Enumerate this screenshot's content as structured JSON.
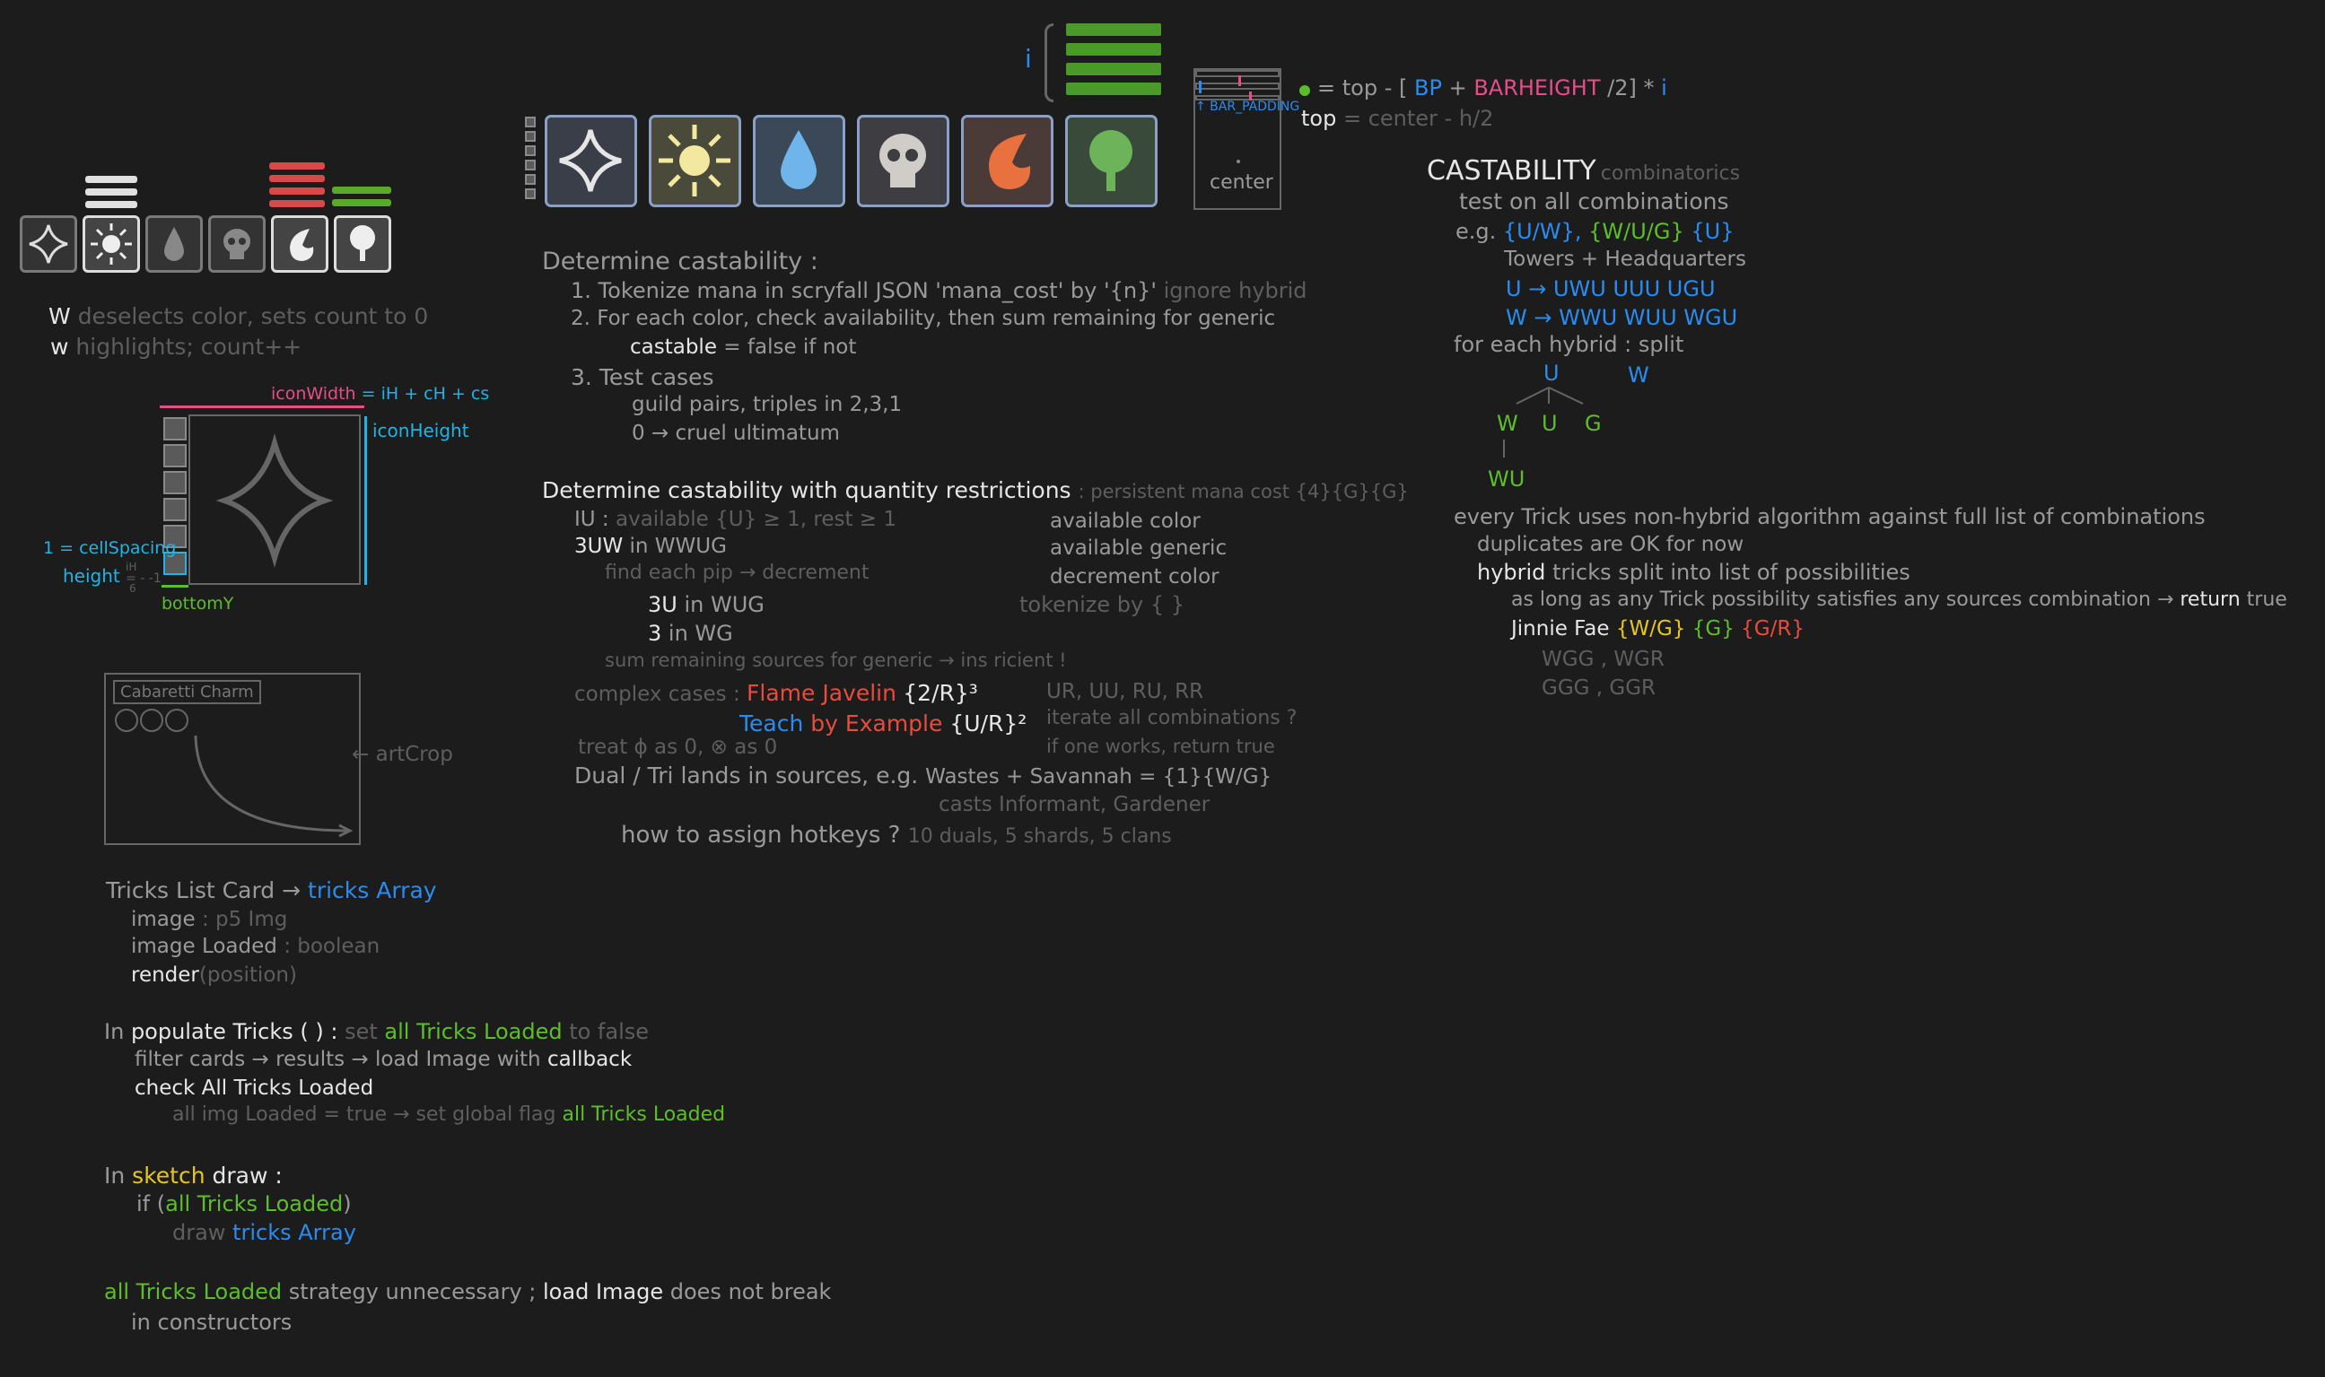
{
  "colors": {
    "blue": "#2a8cf0",
    "green": "#5cbf2a",
    "pink": "#e54f86",
    "red": "#e84c3d",
    "yellow": "#e7c520",
    "gray": "#9a9a9a",
    "dim": "#5e5e5e",
    "white": "#e6e6e6"
  },
  "icons": [
    "colorless-diamond-icon",
    "white-sun-icon",
    "blue-drop-icon",
    "black-skull-icon",
    "red-fire-icon",
    "green-tree-icon"
  ],
  "left": {
    "deselect_key": "W",
    "deselect_text": "deselects color, sets count to 0",
    "highlight_key": "w",
    "highlight_text": "highlights; count++",
    "icon_width": "iconWidth",
    "icon_width_formula": "= iH + cH + cs",
    "icon_height": "iconHeight",
    "cell_spacing": "1 = cellSpacing",
    "height_label": "height",
    "height_frac_top": "iH",
    "height_frac_bottom": "6",
    "height_minus": "= - -1",
    "bottom_y": "bottomY",
    "card_name": "Cabaretti Charm",
    "art_crop": "artCrop",
    "tricks_l1a": "Tricks List Card",
    "tricks_l1_arrow": "→",
    "tricks_l1b": "tricks Array",
    "image_key": "image",
    "image_val": ": p5 Img",
    "image_loaded_key": "image Loaded",
    "image_loaded_val": ": boolean",
    "render_key": "render",
    "render_val": "(position)",
    "populate_in": "In",
    "populate_fn": "populate Tricks ( ) :",
    "populate_set": "set",
    "populate_flag": "all Tricks Loaded",
    "populate_false": "to false",
    "filter_line_a": "filter cards → results → load Image with",
    "filter_line_b": "callback",
    "check_all": "check All Tricks Loaded",
    "all_loaded_a": "all img Loaded = true → set global flag",
    "all_loaded_b": "all Tricks Loaded",
    "sketch_in": "In",
    "sketch_word": "sketch",
    "draw_word": "draw :",
    "if_a": "if (",
    "if_b": "all Tricks Loaded",
    "if_c": ")",
    "draw2_a": "draw",
    "draw2_b": "tricks Array",
    "final_a": "all Tricks Loaded",
    "final_b": "strategy unnecessary ;",
    "final_c": "load Image",
    "final_d": "does not break",
    "final_e": "in constructors"
  },
  "top": {
    "i_label": "i",
    "formula_top": "= top - [",
    "formula_bp": "BP",
    "formula_plus": "+",
    "formula_barheight": "BARHEIGHT",
    "formula_div": "/2] *",
    "formula_i": "i",
    "top2": "top",
    "top2_rest": "= center - h/2",
    "bar_padding": "↑ BAR_PADDING",
    "center": "center"
  },
  "middle": {
    "det_title": "Determine castability :",
    "n1": "1.",
    "l1": "Tokenize mana in scryfall JSON 'mana_cost' by '{n}'",
    "l1_dim": "ignore hybrid",
    "n2": "2.",
    "l2": "For each color, check availability, then sum remaining for generic",
    "l2b_key": "castable",
    "l2b_val": "= false if not",
    "n3": "3.",
    "l3": "Test cases",
    "l3a": "guild pairs, triples in 2,3,1",
    "l3b": "0 → cruel ultimatum",
    "q_title": "Determine castability with quantity restrictions",
    "q_title_dim": ": persistent mana cost  {4}{G}{G}",
    "iu_key": "IU :",
    "iu_val": "available {U} ≥ 1, rest ≥ 1",
    "w3uw_a": "3UW",
    "w3uw_b": "in WWUG",
    "find_pip": "find each pip → decrement",
    "u3_a": "3U",
    "u3_b": "in WUG",
    "n3_a": "3",
    "n3_b": "in WG",
    "avail_color": "available color",
    "avail_generic": "available generic",
    "decr_color": "decrement color",
    "tokenize": "tokenize by { }",
    "sum_remaining": "sum remaining sources for generic → ins ricient !",
    "complex": "complex cases :",
    "flame": "Flame Javelin",
    "flame_cost": "{2/R}³",
    "teach_a": "Teach",
    "teach_b": "by",
    "teach_c": "Example",
    "teach_cost": "{U/R}²",
    "ur_list": "UR, UU, RU, RR",
    "iterate": "iterate all combinations ?",
    "one_works": "if one works, return true",
    "treat": "treat ϕ as 0, ⊗ as 0",
    "dual_a": "Dual / Tri lands in sources, e.g.",
    "dual_b": "Wastes + Savannah = {1}{W/G}",
    "casts": "casts Informant, Gardener",
    "hotkeys_a": "how to assign hotkeys ?",
    "hotkeys_b": "10 duals, 5 shards, 5 clans"
  },
  "right": {
    "cast_title": "CASTABILITY",
    "cast_sub": "combinatorics",
    "test_all": "test on all combinations",
    "eg": "e.g.",
    "eg_uw": "{U/W},",
    "eg_wug": "{W/U/G}",
    "eg_u": "{U}",
    "towers": "Towers + Headquarters",
    "u_arrow": "U →",
    "u_combo": "UWU  UUU  UGU",
    "w_arrow": "W →",
    "w_combo": "WWU  WUU  WGU",
    "each_hybrid": "for each hybrid :  split",
    "tree_u": "U",
    "tree_w": "W",
    "tree_w2": "W",
    "tree_u2": "U",
    "tree_g": "G",
    "tree_wu": "WU",
    "every_trick": "every Trick uses non-hybrid algorithm against full list of combinations",
    "duplicates": "duplicates are OK for now",
    "hybrid_a": "hybrid",
    "hybrid_b": "tricks split into list of possibilities",
    "aslong_a": "as long as any Trick possibility satisfies any sources combination →",
    "aslong_b": "return",
    "aslong_c": "true",
    "jinnie": "Jinnie Fae",
    "jinnie_c1": "{W/G}",
    "jinnie_c2": "{G}",
    "jinnie_c3": "{G/R}",
    "wgg": "WGG , WGR",
    "ggg": "GGG , GGR"
  }
}
